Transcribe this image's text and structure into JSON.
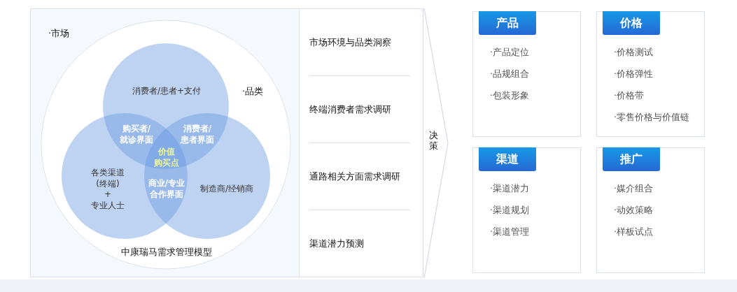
{
  "venn": {
    "labels": [
      {
        "kind": "outer",
        "lines": [
          "·市场"
        ]
      },
      {
        "kind": "outer",
        "lines": [
          "·品类"
        ]
      },
      {
        "kind": "circle",
        "lines": [
          "消费者/患者+支付"
        ]
      },
      {
        "kind": "overlap",
        "lines": [
          "购买者/",
          "就诊界面"
        ]
      },
      {
        "kind": "overlap",
        "lines": [
          "消费者/",
          "患者界面"
        ]
      },
      {
        "kind": "center",
        "lines": [
          "价值",
          "购买点"
        ]
      },
      {
        "kind": "circle",
        "lines": [
          "各类渠道",
          "(终端)",
          "+",
          "专业人士"
        ]
      },
      {
        "kind": "overlap",
        "lines": [
          "商业/专业",
          "合作界面"
        ]
      },
      {
        "kind": "circle",
        "lines": [
          "制造商/经销商"
        ]
      }
    ],
    "caption": "中康瑞马需求管理模型"
  },
  "research": [
    "市场环境与品类洞察",
    "终端消费者需求调研",
    "通路相关方面需求调研",
    "渠道潜力预测"
  ],
  "decision": "决策",
  "cards": [
    {
      "title": "产品",
      "items": [
        "·产品定位",
        "·品规组合",
        "·包装形象"
      ]
    },
    {
      "title": "价格",
      "items": [
        "·价格测试",
        "·价格弹性",
        "·价格带",
        "·零售价格与价值链"
      ]
    },
    {
      "title": "渠道",
      "items": [
        "·渠道潜力",
        "·渠道规划",
        "·渠道管理"
      ]
    },
    {
      "title": "推广",
      "items": [
        "·媒介组合",
        "·动效策略",
        "·样板试点"
      ]
    }
  ]
}
